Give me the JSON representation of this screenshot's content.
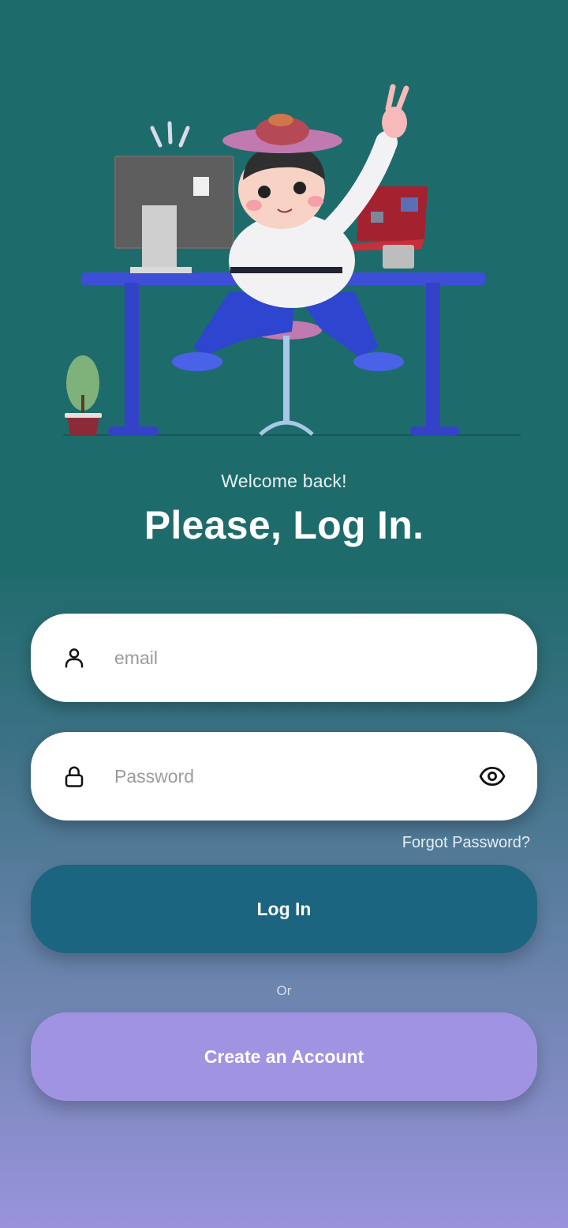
{
  "hero": {
    "illustration": "person-at-desk-illustration"
  },
  "header": {
    "welcome": "Welcome back!",
    "title": "Please, Log In."
  },
  "form": {
    "email": {
      "placeholder": "email",
      "value": "",
      "icon": "user-icon"
    },
    "password": {
      "placeholder": "Password",
      "value": "",
      "icon": "lock-icon",
      "toggle_icon": "eye-icon"
    },
    "forgot_label": "Forgot Password?",
    "login_label": "Log In",
    "or_label": "Or",
    "create_label": "Create an Account"
  },
  "colors": {
    "background_top": "#1e6b6b",
    "background_bottom": "#9a93dd",
    "login_button": "#1b6580",
    "create_button": "#a094e2",
    "field_background": "#ffffff"
  }
}
